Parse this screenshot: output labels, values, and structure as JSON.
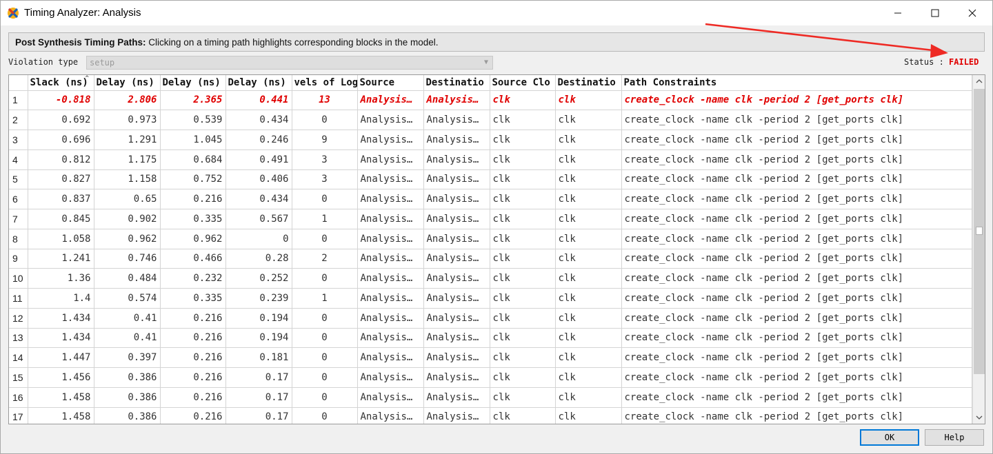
{
  "window": {
    "title": "Timing Analyzer: Analysis",
    "icon": "app-logo-icon"
  },
  "info": {
    "title": "Post Synthesis Timing Paths:",
    "text": " Clicking on a timing path highlights corresponding blocks in the model."
  },
  "violation": {
    "label": "Violation type",
    "value": "setup"
  },
  "status": {
    "label": "Status :",
    "value": "FAILED"
  },
  "colors": {
    "failed": "#e00000",
    "accent": "#0078d7"
  },
  "table": {
    "columns": [
      "",
      "Slack (ns)",
      "Delay (ns)",
      "Delay (ns)",
      "Delay (ns)",
      "vels of Log",
      "Source",
      "Destinatio",
      "Source Clo",
      "Destinatio",
      "Path Constraints"
    ],
    "rows": [
      [
        "1",
        "-0.818",
        "2.806",
        "2.365",
        "0.441",
        "13",
        "Analysis…",
        "Analysis…",
        "clk",
        "clk",
        "create_clock -name clk -period 2 [get_ports clk]"
      ],
      [
        "2",
        "0.692",
        "0.973",
        "0.539",
        "0.434",
        "0",
        "Analysis…",
        "Analysis…",
        "clk",
        "clk",
        "create_clock -name clk -period 2 [get_ports clk]"
      ],
      [
        "3",
        "0.696",
        "1.291",
        "1.045",
        "0.246",
        "9",
        "Analysis…",
        "Analysis…",
        "clk",
        "clk",
        "create_clock -name clk -period 2 [get_ports clk]"
      ],
      [
        "4",
        "0.812",
        "1.175",
        "0.684",
        "0.491",
        "3",
        "Analysis…",
        "Analysis…",
        "clk",
        "clk",
        "create_clock -name clk -period 2 [get_ports clk]"
      ],
      [
        "5",
        "0.827",
        "1.158",
        "0.752",
        "0.406",
        "3",
        "Analysis…",
        "Analysis…",
        "clk",
        "clk",
        "create_clock -name clk -period 2 [get_ports clk]"
      ],
      [
        "6",
        "0.837",
        "0.65",
        "0.216",
        "0.434",
        "0",
        "Analysis…",
        "Analysis…",
        "clk",
        "clk",
        "create_clock -name clk -period 2 [get_ports clk]"
      ],
      [
        "7",
        "0.845",
        "0.902",
        "0.335",
        "0.567",
        "1",
        "Analysis…",
        "Analysis…",
        "clk",
        "clk",
        "create_clock -name clk -period 2 [get_ports clk]"
      ],
      [
        "8",
        "1.058",
        "0.962",
        "0.962",
        "0",
        "0",
        "Analysis…",
        "Analysis…",
        "clk",
        "clk",
        "create_clock -name clk -period 2 [get_ports clk]"
      ],
      [
        "9",
        "1.241",
        "0.746",
        "0.466",
        "0.28",
        "2",
        "Analysis…",
        "Analysis…",
        "clk",
        "clk",
        "create_clock -name clk -period 2 [get_ports clk]"
      ],
      [
        "10",
        "1.36",
        "0.484",
        "0.232",
        "0.252",
        "0",
        "Analysis…",
        "Analysis…",
        "clk",
        "clk",
        "create_clock -name clk -period 2 [get_ports clk]"
      ],
      [
        "11",
        "1.4",
        "0.574",
        "0.335",
        "0.239",
        "1",
        "Analysis…",
        "Analysis…",
        "clk",
        "clk",
        "create_clock -name clk -period 2 [get_ports clk]"
      ],
      [
        "12",
        "1.434",
        "0.41",
        "0.216",
        "0.194",
        "0",
        "Analysis…",
        "Analysis…",
        "clk",
        "clk",
        "create_clock -name clk -period 2 [get_ports clk]"
      ],
      [
        "13",
        "1.434",
        "0.41",
        "0.216",
        "0.194",
        "0",
        "Analysis…",
        "Analysis…",
        "clk",
        "clk",
        "create_clock -name clk -period 2 [get_ports clk]"
      ],
      [
        "14",
        "1.447",
        "0.397",
        "0.216",
        "0.181",
        "0",
        "Analysis…",
        "Analysis…",
        "clk",
        "clk",
        "create_clock -name clk -period 2 [get_ports clk]"
      ],
      [
        "15",
        "1.456",
        "0.386",
        "0.216",
        "0.17",
        "0",
        "Analysis…",
        "Analysis…",
        "clk",
        "clk",
        "create_clock -name clk -period 2 [get_ports clk]"
      ],
      [
        "16",
        "1.458",
        "0.386",
        "0.216",
        "0.17",
        "0",
        "Analysis…",
        "Analysis…",
        "clk",
        "clk",
        "create_clock -name clk -period 2 [get_ports clk]"
      ],
      [
        "17",
        "1.458",
        "0.386",
        "0.216",
        "0.17",
        "0",
        "Analysis…",
        "Analysis…",
        "clk",
        "clk",
        "create_clock -name clk -period 2 [get_ports clk]"
      ]
    ],
    "failed_rows": [
      0
    ]
  },
  "buttons": {
    "ok": "OK",
    "help": "Help"
  }
}
